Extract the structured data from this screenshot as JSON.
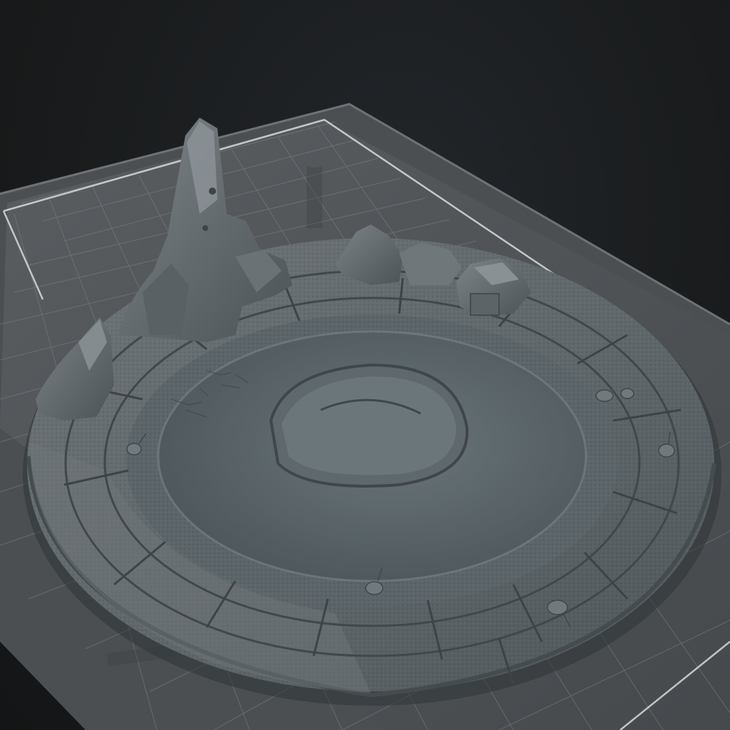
{
  "viewport": {
    "kind": "3d-slicer-preview",
    "background_color": "#1b1d1e",
    "build_plate_color": "#6b6f72",
    "grid_color": "#8f9497",
    "model_color": "#5b6367"
  },
  "scene": {
    "object": "circular-stone-ring-diorama",
    "features": [
      "tall-rock-spire",
      "rock-cluster",
      "small-rock",
      "central-pool",
      "crater",
      "small-creatures"
    ]
  }
}
